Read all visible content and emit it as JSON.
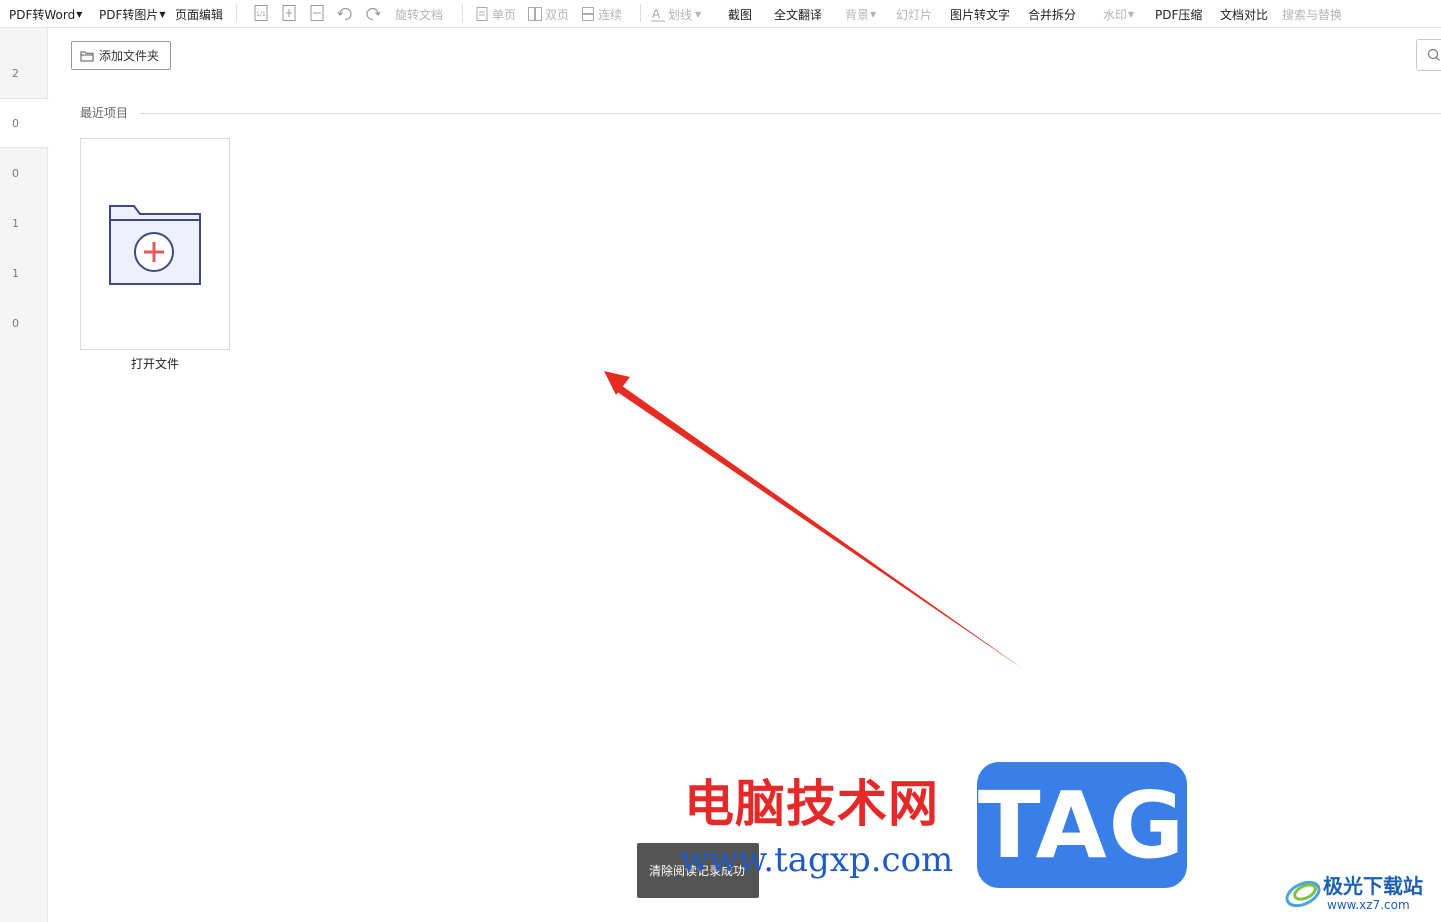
{
  "toolbar": {
    "pdf_to_word": "PDF转Word",
    "pdf_to_image": "PDF转图片",
    "page_edit": "页面编辑",
    "rotate_doc": "旋转文档",
    "single_page": "单页",
    "double_page": "双页",
    "continuous": "连续",
    "underline": "划线",
    "screenshot": "截图",
    "full_translate": "全文翻译",
    "background": "背景",
    "slideshow": "幻灯片",
    "image_to_text": "图片转文字",
    "merge_split": "合并拆分",
    "watermark": "水印",
    "pdf_compress": "PDF压缩",
    "doc_compare": "文档对比",
    "search_replace": "搜索与替换"
  },
  "sidebar": {
    "items": [
      "2",
      "0",
      "0",
      "1",
      "1",
      "0"
    ]
  },
  "main": {
    "add_folder": "添加文件夹",
    "section_title": "最近项目",
    "open_file": "打开文件"
  },
  "toast": {
    "text": "清除阅读记录成功"
  },
  "watermark": {
    "title": "电脑技术网",
    "url": "www.tagxp.com",
    "tag": "TAG",
    "site_name": "极光下载站",
    "site_url": "www.xz7.com"
  },
  "colors": {
    "accent_red": "#e52828",
    "tag_blue": "#3a7fe8",
    "folder_stroke": "#3d4a8a",
    "folder_fill": "#eef0fa",
    "plus_red": "#e05a5a"
  }
}
